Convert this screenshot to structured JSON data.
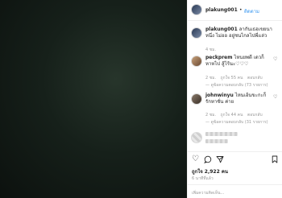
{
  "post": {
    "owner_username": "plakung001",
    "follow_label": "ติดตาม",
    "caption_username": "plakung001",
    "caption_text": "ลากันเธอเขยนาหนึ่ง ไม่ออ อยู่ชนไกลไปพี่แล่ว",
    "caption_time": "4 ชม."
  },
  "comments": [
    {
      "username": "peckprem",
      "text": "ไหนยพดี เดวก็หาหไป สู้ไร้นะ♡♡♡",
      "time": "2 ชม.",
      "likes": "ถูกใจ 55 คน",
      "reply": "ตอบกลับ",
      "view_replies": "— ดูข้อความตอบกลับ (73 รายการ)"
    },
    {
      "username": "johnwinyu",
      "text": "ไหนเอ้นขะกะก็รักหาชั่น ค่าย",
      "time": "2 ชม.",
      "likes": "ถูกใจ 44 คน",
      "reply": "ตอบกลับ",
      "view_replies": "— ดูข้อความตอบกลับ (31 รายการ)"
    }
  ],
  "icons": {
    "like": "heart-icon",
    "comment": "comment-icon",
    "share": "share-icon",
    "save": "bookmark-icon"
  },
  "likes_count": "ถูกใจ 2,922 คน",
  "post_date": "6 นาทีที่แล้ว",
  "add_comment_placeholder": "เพิ่มความคิดเห็น..."
}
